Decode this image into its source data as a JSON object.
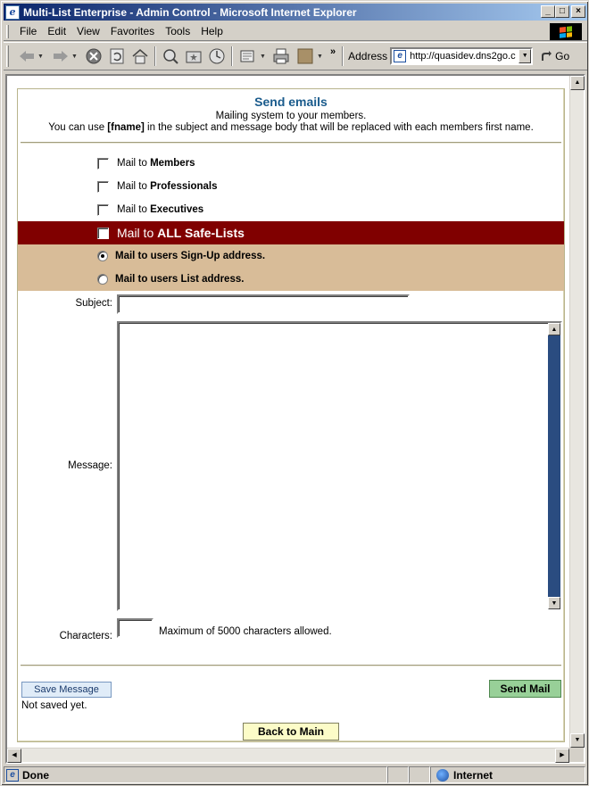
{
  "window": {
    "title": "Multi-List Enterprise - Admin Control - Microsoft Internet Explorer",
    "controls": [
      "minimize",
      "maximize",
      "close"
    ]
  },
  "menu": {
    "items": [
      {
        "label": "File"
      },
      {
        "label": "Edit"
      },
      {
        "label": "View"
      },
      {
        "label": "Favorites"
      },
      {
        "label": "Tools"
      },
      {
        "label": "Help"
      }
    ]
  },
  "toolbar": {
    "address_label": "Address",
    "address_value": "http://quasidev.dns2go.c",
    "go_label": "Go",
    "overflow": "»"
  },
  "page": {
    "title": "Send emails",
    "subtitle": "Mailing system to your members.",
    "note_pre": "You can use ",
    "note_token": "[fname]",
    "note_post": " in the subject and message body that will be replaced with each members first name.",
    "mail_prefix": "Mail to ",
    "options": [
      {
        "group": "Members",
        "checked": false
      },
      {
        "group": "Professionals",
        "checked": false
      },
      {
        "group": "Executives",
        "checked": false
      }
    ],
    "all_lists": {
      "group": "ALL Safe-Lists",
      "checked": false
    },
    "address_options": [
      {
        "label": "Mail to users Sign-Up address.",
        "selected": true
      },
      {
        "label": "Mail to users List address.",
        "selected": false
      }
    ],
    "subject_label": "Subject:",
    "subject_value": "",
    "message_label": "Message:",
    "message_value": "",
    "characters_label": "Characters:",
    "characters_value": "",
    "characters_note": "Maximum of 5000 characters allowed.",
    "save_button": "Save Message",
    "save_status": "Not saved yet.",
    "send_button": "Send Mail",
    "back_button": "Back to Main"
  },
  "status": {
    "text": "Done",
    "zone": "Internet"
  },
  "colors": {
    "title_gradient_start": "#0a246a",
    "heading": "#1a5b8c",
    "all_lists_row": "#800000",
    "address_rows": "#d8bc98",
    "send_button": "#98d098",
    "back_button": "#fcfcc8"
  }
}
